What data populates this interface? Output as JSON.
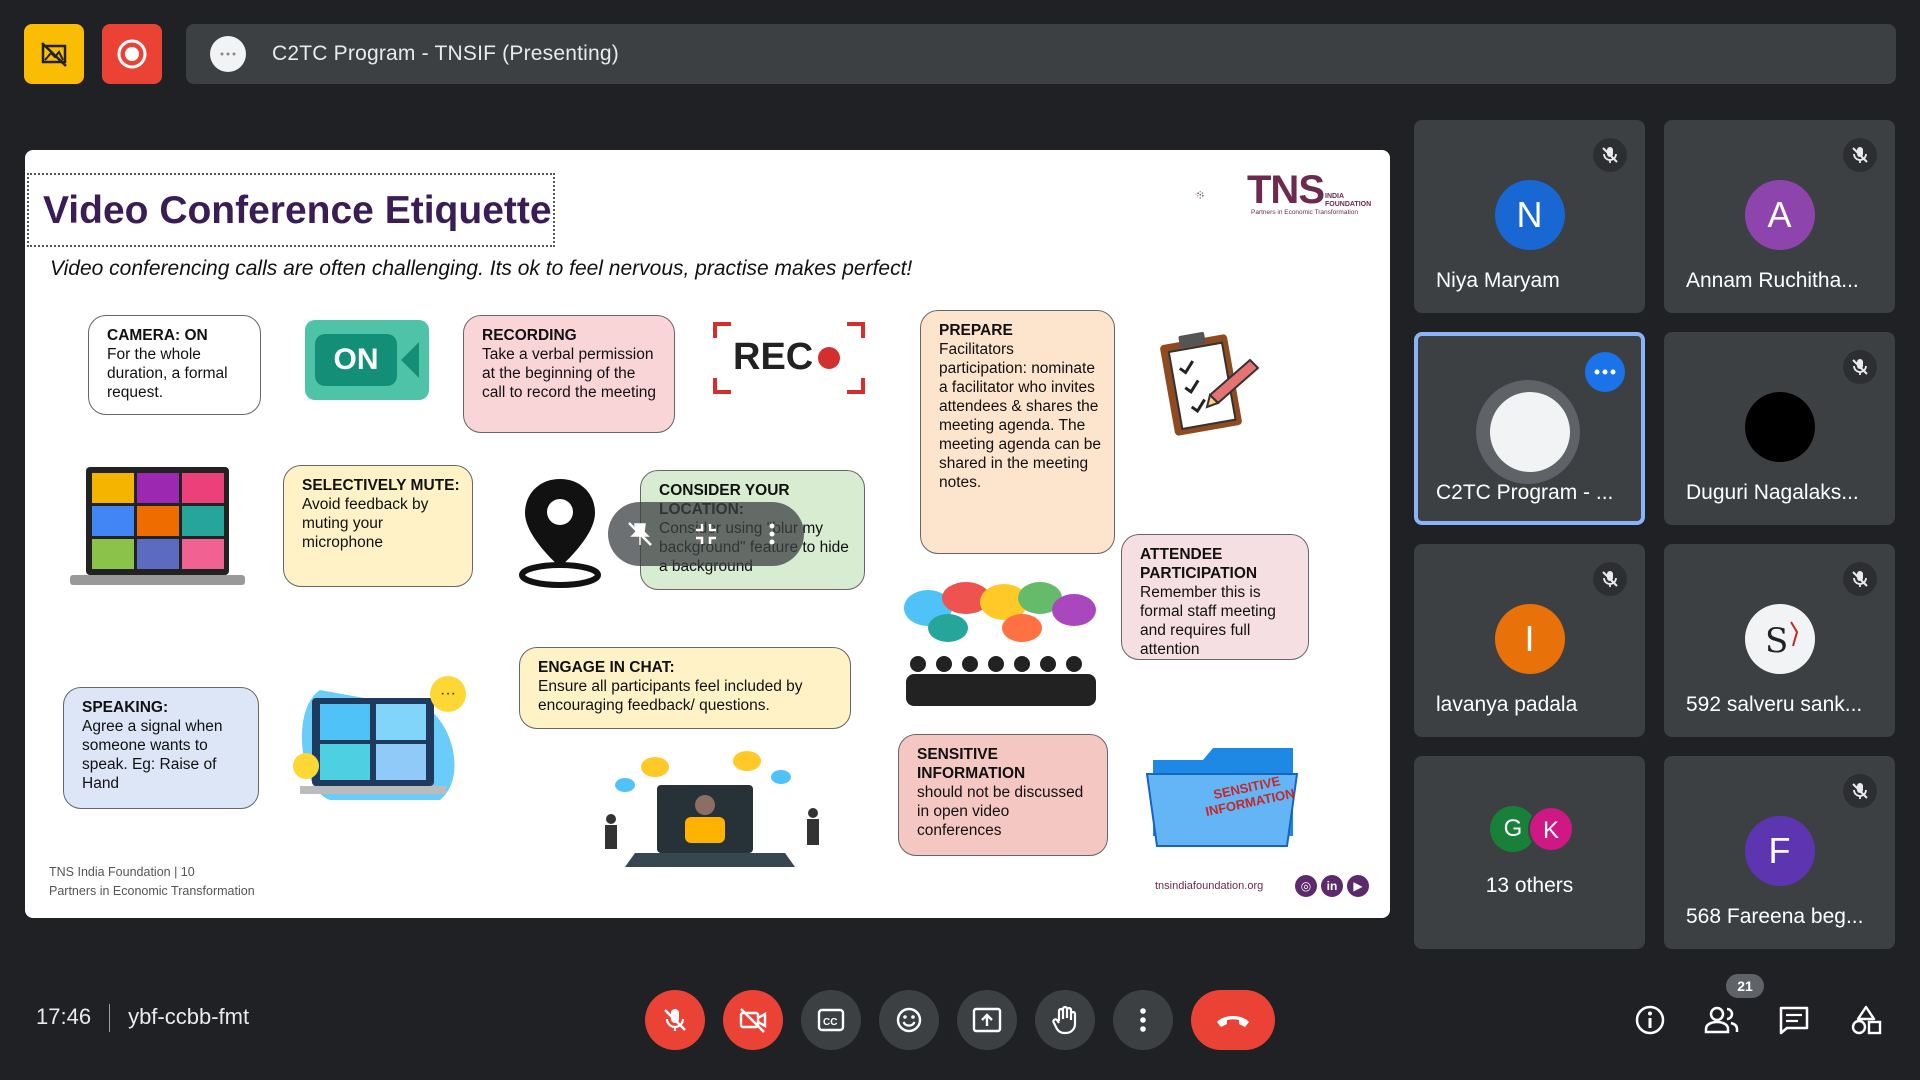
{
  "meeting": {
    "title": "C2TC Program - TNSIF (Presenting)",
    "time": "17:46",
    "code": "ybf-ccbb-fmt",
    "participant_count": "21"
  },
  "slide": {
    "title": "Video Conference Etiquette",
    "subtitle": "Video conferencing calls are often challenging. Its ok to feel nervous, practise makes perfect!",
    "logo": {
      "name": "TNS",
      "india": "INDIA",
      "foundation": "FOUNDATION",
      "tagline": "Partners in Economic Transformation"
    },
    "bubbles": {
      "camera": {
        "head": "CAMERA: ON",
        "body": "For the whole duration, a formal request."
      },
      "recording": {
        "head": "RECORDING",
        "body": "Take a verbal permission at the beginning of the call to record the meeting"
      },
      "prepare": {
        "head": "PREPARE",
        "body": "Facilitators participation: nominate a facilitator who invites attendees & shares the meeting agenda. The meeting agenda can be shared in the meeting notes."
      },
      "mute": {
        "head": "SELECTIVELY MUTE:",
        "body": "Avoid feedback by muting your microphone"
      },
      "location": {
        "head": "CONSIDER YOUR LOCATION:",
        "body": "Consider using \"blur my background\" feature to hide a background"
      },
      "attendee": {
        "head": "ATTENDEE PARTICIPATION",
        "body": "Remember this is formal staff meeting and requires full attention"
      },
      "chat": {
        "head": "ENGAGE IN CHAT:",
        "body": "Ensure all participants feel included by encouraging feedback/ questions."
      },
      "speaking": {
        "head": "SPEAKING:",
        "body": "Agree a signal when someone wants to speak. Eg: Raise of Hand"
      },
      "sensitive": {
        "head": "SENSITIVE INFORMATION",
        "body": "should not be discussed in open video conferences"
      }
    },
    "on_label": "ON",
    "rec_label": "REC",
    "folder_label_1": "SENSITIVE",
    "folder_label_2": "INFORMATION",
    "footer_left_1": "TNS India Foundation | 10",
    "footer_left_2": "Partners in Economic Transformation",
    "footer_right": "tnsindiafoundation.org",
    "social": [
      "◎",
      "in",
      "▶"
    ]
  },
  "participants": [
    {
      "initial": "N",
      "name": "Niya Maryam",
      "color": "#1967d2",
      "muted": true
    },
    {
      "initial": "A",
      "name": "Annam Ruchitha...",
      "color": "#8e44ad",
      "muted": true
    },
    {
      "initial": "",
      "name": "C2TC Program - ...",
      "color": "#e0e0e0",
      "muted": false,
      "active": true
    },
    {
      "initial": "",
      "name": "Duguri Nagalaks...",
      "color": "#000000",
      "muted": true
    },
    {
      "initial": "I",
      "name": "lavanya padala",
      "color": "#e8710a",
      "muted": true
    },
    {
      "initial": "",
      "name": "592 salveru sank...",
      "color": "#f1f3f4",
      "muted": true
    },
    {
      "others": "13 others",
      "g": "G",
      "k": "K"
    },
    {
      "initial": "F",
      "name": "568 Fareena beg...",
      "color": "#5e35b1",
      "muted": true
    }
  ],
  "colors": {
    "background": "#202124",
    "tile": "#3c4043",
    "red": "#ea4335",
    "yellow": "#fbbc04",
    "blue": "#1a73e8"
  }
}
